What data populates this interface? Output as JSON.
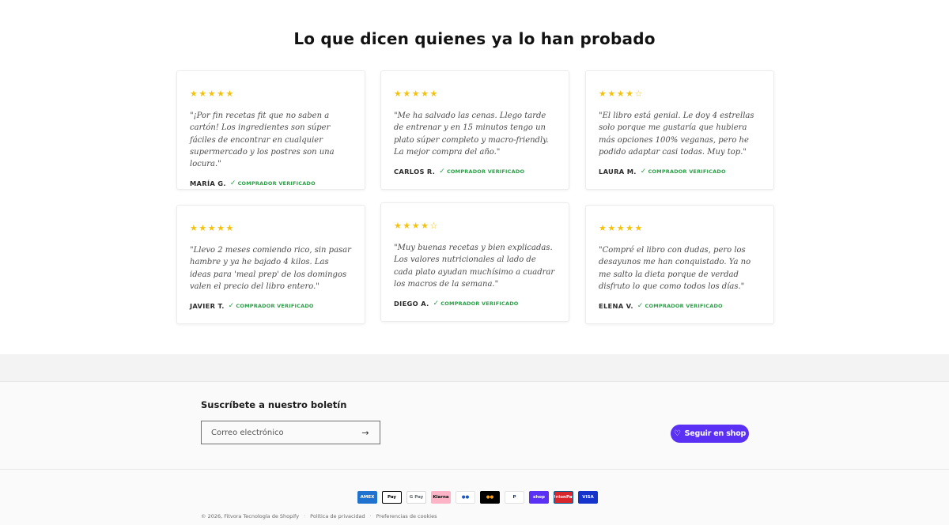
{
  "reviews": {
    "title": "Lo que dicen quienes ya lo han probado",
    "verified_label": "COMPRADOR VERIFICADO",
    "items": [
      {
        "stars": "★★★★★",
        "rating": 5,
        "quote": "\"¡Por fin recetas fit que no saben a cartón! Los ingredientes son súper fáciles de encontrar en cualquier supermercado y los postres son una locura.\"",
        "author": "MARÍA G."
      },
      {
        "stars": "★★★★★",
        "rating": 5,
        "quote": "\"Me ha salvado las cenas. Llego tarde de entrenar y en 15 minutos tengo un plato súper completo y macro-friendly. La mejor compra del año.\"",
        "author": "CARLOS R."
      },
      {
        "stars": "★★★★☆",
        "rating": 4,
        "quote": "\"El libro está genial. Le doy 4 estrellas solo porque me gustaría que hubiera más opciones 100% veganas, pero he podido adaptar casi todas. Muy top.\"",
        "author": "LAURA M."
      },
      {
        "stars": "★★★★★",
        "rating": 5,
        "quote": "\"Llevo 2 meses comiendo rico, sin pasar hambre y ya he bajado 4 kilos. Las ideas para 'meal prep' de los domingos valen el precio del libro entero.\"",
        "author": "JAVIER T."
      },
      {
        "stars": "★★★★☆",
        "rating": 4,
        "quote": "\"Muy buenas recetas y bien explicadas. Los valores nutricionales al lado de cada plato ayudan muchísimo a cuadrar los macros de la semana.\"",
        "author": "DIEGO A."
      },
      {
        "stars": "★★★★★",
        "rating": 5,
        "quote": "\"Compré el libro con dudas, pero los desayunos me han conquistado. Ya no me salto la dieta porque de verdad disfruto lo que como todos los días.\"",
        "author": "ELENA V."
      }
    ]
  },
  "newsletter": {
    "title": "Suscríbete a nuestro boletín",
    "email_placeholder": "Correo electrónico",
    "submit_icon": "→"
  },
  "shop_follow": {
    "label": "Seguir en shop",
    "icon": "♡"
  },
  "payments": [
    {
      "label": "AMEX",
      "bg": "#1f72cd",
      "fg": "#ffffff",
      "border": "#1f72cd"
    },
    {
      "label": "Pay",
      "bg": "#ffffff",
      "fg": "#000000",
      "border": "#000000"
    },
    {
      "label": "G Pay",
      "bg": "#ffffff",
      "fg": "#5f6368",
      "border": "#d9d9d9"
    },
    {
      "label": "Klarna",
      "bg": "#ffb3c7",
      "fg": "#0a0a0a",
      "border": "#ffb3c7"
    },
    {
      "label": "●●",
      "bg": "#ffffff",
      "fg": "#1e58c4",
      "border": "#e2e2e2"
    },
    {
      "label": "●●",
      "bg": "#000000",
      "fg": "#f79e1b",
      "border": "#000000"
    },
    {
      "label": "P",
      "bg": "#ffffff",
      "fg": "#003087",
      "border": "#e2e2e2"
    },
    {
      "label": "shop",
      "bg": "#5a31f4",
      "fg": "#ffffff",
      "border": "#5a31f4"
    },
    {
      "label": "UnionPay",
      "bg": "#d7262c",
      "fg": "#ffffff",
      "border": "#005d8f"
    },
    {
      "label": "VISA",
      "bg": "#1434cb",
      "fg": "#ffffff",
      "border": "#1434cb"
    }
  ],
  "footer": {
    "copyright": "© 2026, Fitvora Tecnología de Shopify",
    "privacy": "Política de privacidad",
    "cookies": "Preferencias de cookies",
    "separator": "·"
  }
}
